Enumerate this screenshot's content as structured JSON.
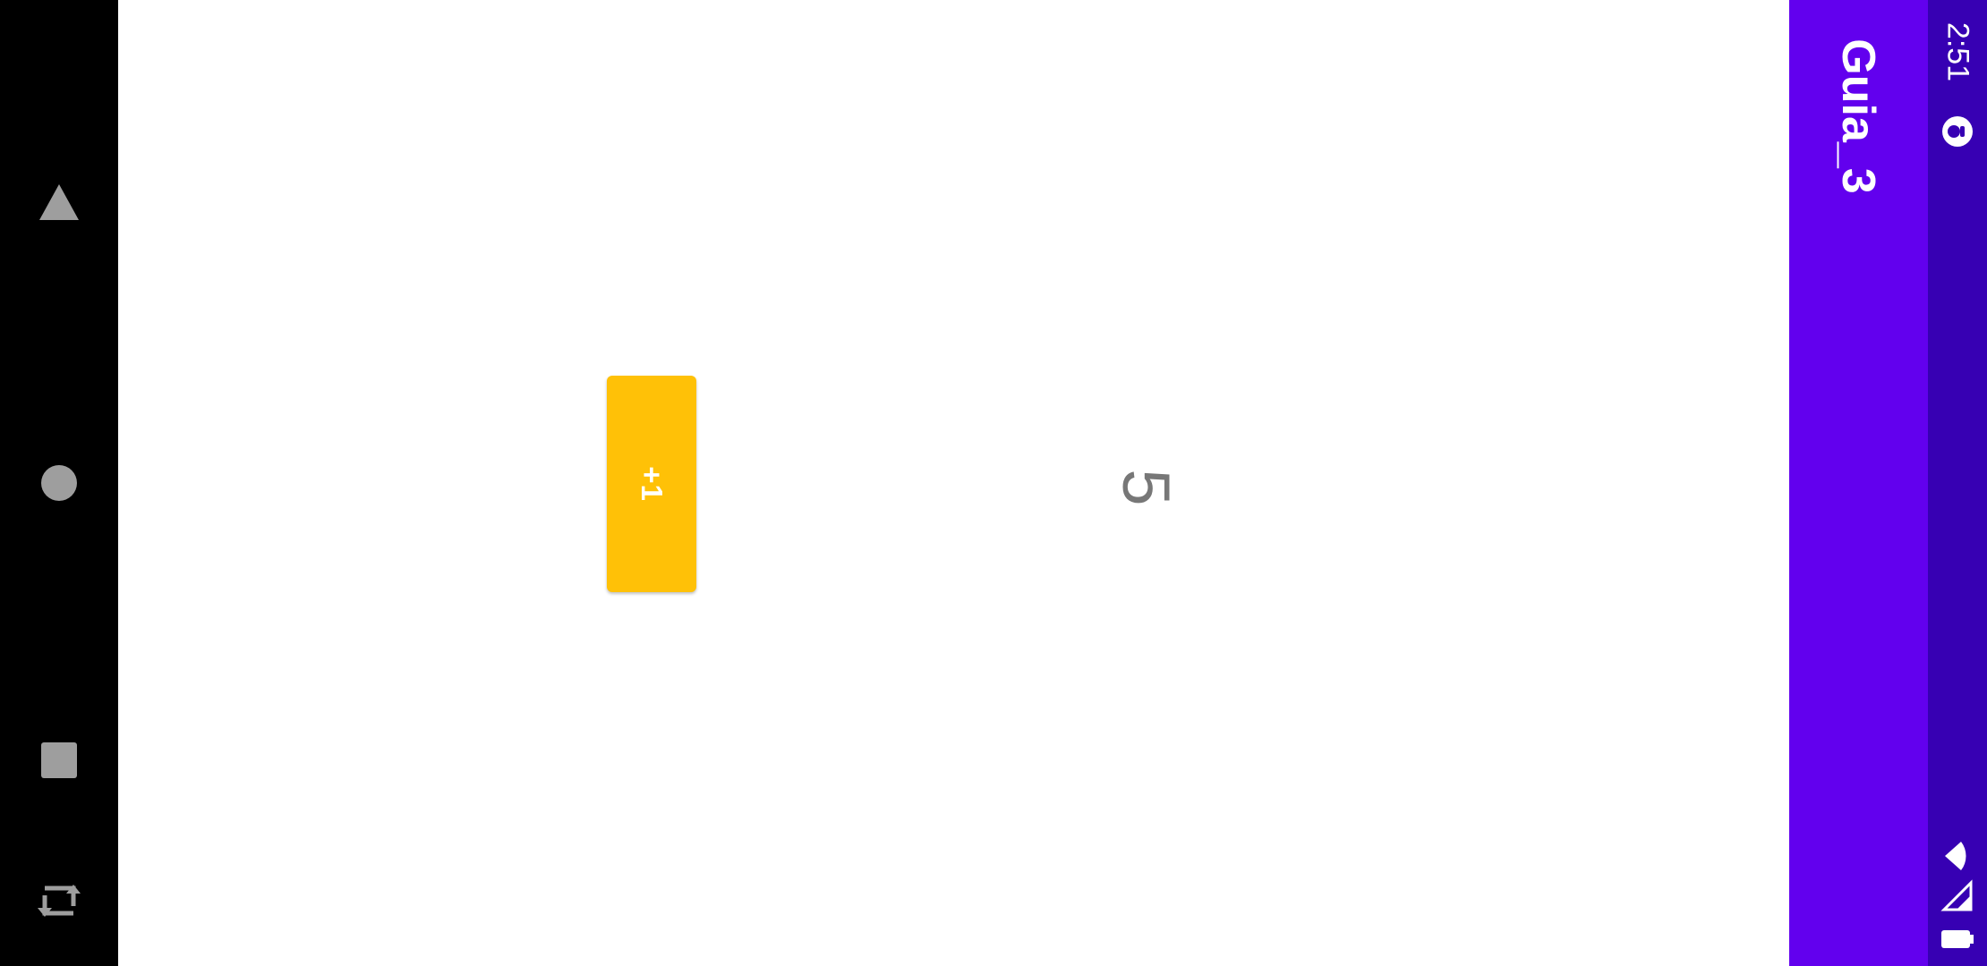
{
  "status_bar": {
    "time": "2:51",
    "icons": [
      "notification-icon",
      "wifi-icon",
      "cell-signal-icon",
      "battery-icon"
    ]
  },
  "app_bar": {
    "title": "Guia_3",
    "color": "#6200EE"
  },
  "main": {
    "counter_value": "5",
    "increment_button_label": "+1",
    "button_color": "#FFC107"
  },
  "nav_bar": {
    "buttons": [
      "back-icon",
      "home-icon",
      "recents-icon",
      "rotate-icon"
    ]
  }
}
